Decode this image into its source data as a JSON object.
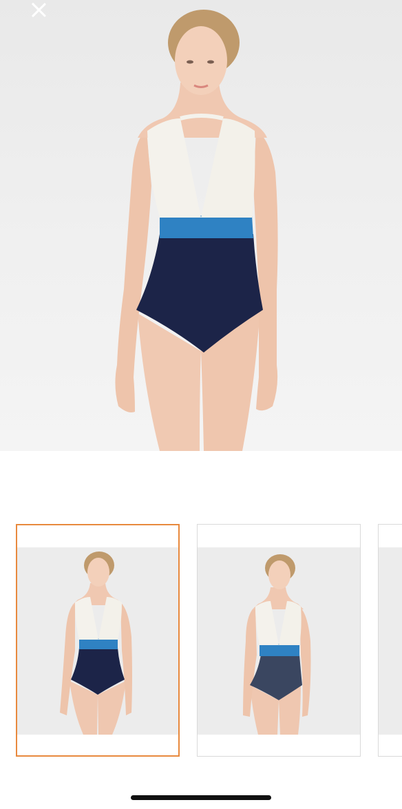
{
  "header": {
    "close_icon": "close-icon"
  },
  "product": {
    "main_image": {
      "kind": "model-photo",
      "colors": [
        "#f4f2ec",
        "#2f82c3",
        "#1c2448"
      ]
    }
  },
  "gallery": {
    "selected_index": 0,
    "selected_border_color": "#e8893d",
    "thumbnails": [
      {
        "selected": true,
        "colors": [
          "#f4f2ec",
          "#2f82c3",
          "#1c2448"
        ]
      },
      {
        "selected": false,
        "colors": [
          "#f4f2ec",
          "#2f82c3",
          "#3a4660"
        ]
      },
      {
        "selected": false
      }
    ]
  },
  "colors": {
    "accent": "#e8893d",
    "navy": "#1c2448",
    "blue": "#2f82c3",
    "cream": "#f4f2ec"
  }
}
